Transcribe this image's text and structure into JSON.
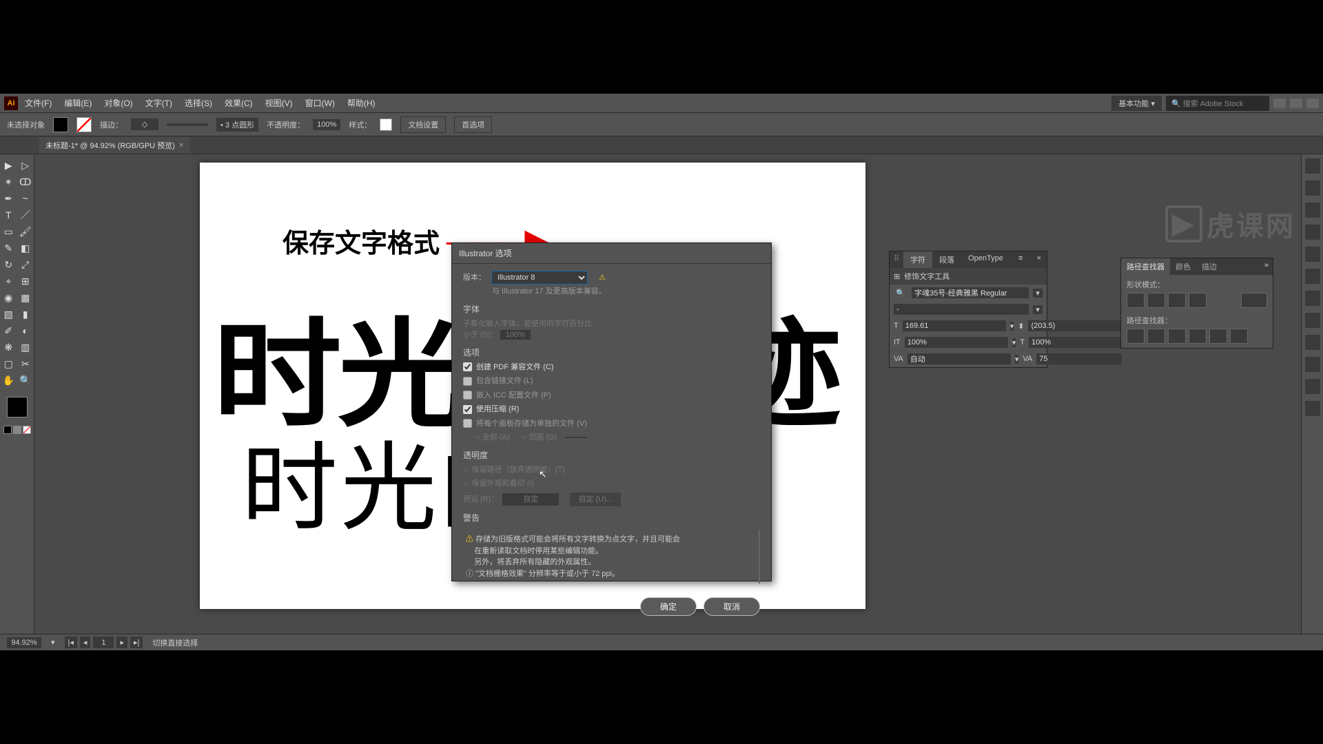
{
  "menubar": {
    "logo": "Ai",
    "items": [
      "文件(F)",
      "编辑(E)",
      "对象(O)",
      "文字(T)",
      "选择(S)",
      "效果(C)",
      "视图(V)",
      "窗口(W)",
      "帮助(H)"
    ],
    "workspace": "基本功能",
    "search_placeholder": "搜索 Adobe Stock"
  },
  "ctrl": {
    "no_select": "未选择对象",
    "stroke": "描边：",
    "stroke_pt": "3 点圆形",
    "opacity_label": "不透明度：",
    "opacity": "100%",
    "style": "样式：",
    "doc_setup": "文档设置",
    "prefs": "首选项"
  },
  "tab": {
    "name": "未标题-1* @ 94.92% (RGB/GPU 预览)"
  },
  "annotation": {
    "text": "保存文字格式"
  },
  "artboard": {
    "line1": "时光的痕迹",
    "line2": "时光的痕迹"
  },
  "char_panel": {
    "tabs": [
      "字符",
      "段落",
      "OpenType"
    ],
    "tool_label": "修饰文字工具",
    "font": "字魂35号-经典雅黑 Regular",
    "style": "-",
    "size": "169.61",
    "leading": "(203.5)",
    "vscale": "100%",
    "hscale": "100%",
    "tracking": "自动",
    "kern": "75"
  },
  "pf_panel": {
    "tabs": [
      "路径查找器",
      "颜色",
      "描边"
    ],
    "mode_label": "形状模式：",
    "pf_label": "路径查找器："
  },
  "dialog": {
    "title": "Illustrator 选项",
    "version_label": "版本：",
    "version_value": "Illustrator 8",
    "compat": "与 Illustrator 17 及更高版本兼容。",
    "fonts_header": "字体",
    "fonts_sub": "子集化嵌入字体，若使用的字符百分比",
    "less_than": "小于 (S)：",
    "less_val": "100%",
    "options_header": "选项",
    "opt_pdf": "创建 PDF 兼容文件 (C)",
    "opt_link": "包含链接文件 (L)",
    "opt_icc": "嵌入 ICC 配置文件 (P)",
    "opt_compress": "使用压缩 (R)",
    "opt_split": "将每个画板存储为单独的文件 (V)",
    "opt_all": "全部 (A)",
    "opt_range": "范围 (G)",
    "trans_header": "透明度",
    "trans_preserve": "保留路径（放弃透明度）(T)",
    "trans_keep": "保留外观和叠印 (I)",
    "preset": "预设 (R)：",
    "preset_val": "自定",
    "custom_btn": "自定 (U)...",
    "warn_header": "警告",
    "warn1": "存储为旧版格式可能会将所有文字转换为点文字，并且可能会",
    "warn2": "在重新读取文档时停用某些编辑功能。",
    "warn3": "另外，将丢弃所有隐藏的外观属性。",
    "warn4": "\"文档栅格效果\" 分辨率等于或小于 72 ppi。",
    "ok": "确定",
    "cancel": "取消"
  },
  "status": {
    "zoom": "94.92%",
    "page": "1",
    "hint": "切换直接选择"
  },
  "watermark": "虎课网"
}
